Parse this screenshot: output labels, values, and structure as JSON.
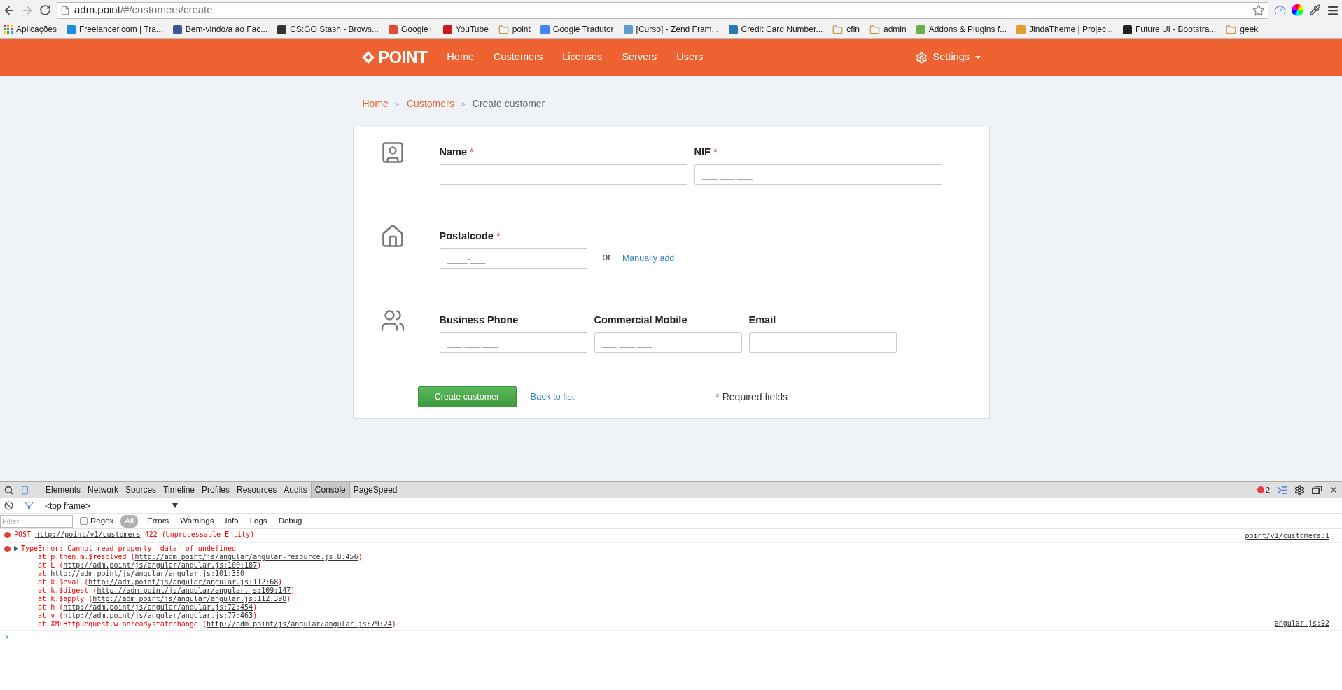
{
  "browser": {
    "url_host": "adm.point",
    "url_path": "/#/customers/create",
    "bookmarks": [
      {
        "kind": "apps",
        "label": "Aplicações"
      },
      {
        "kind": "site",
        "label": "Freelancer.com | Tra...",
        "color": "#1d8fd8"
      },
      {
        "kind": "site",
        "label": "Bem-vindo/a ao Fac...",
        "color": "#3b5998"
      },
      {
        "kind": "site",
        "label": "CS:GO Stash - Brows...",
        "color": "#333333"
      },
      {
        "kind": "site",
        "label": "Google+",
        "color": "#dd4b39"
      },
      {
        "kind": "site",
        "label": "YouTube",
        "color": "#cc181e"
      },
      {
        "kind": "folder",
        "label": "point"
      },
      {
        "kind": "site",
        "label": "Google Tradutor",
        "color": "#4285f4"
      },
      {
        "kind": "site",
        "label": "[Curso] - Zend Fram...",
        "color": "#5aa0c8"
      },
      {
        "kind": "site",
        "label": "Credit Card Number...",
        "color": "#2a7ab0"
      },
      {
        "kind": "folder",
        "label": "cfin"
      },
      {
        "kind": "folder",
        "label": "admin"
      },
      {
        "kind": "site",
        "label": "Addons & Plugins f...",
        "color": "#6ab04c"
      },
      {
        "kind": "site",
        "label": "JindaTheme | Projec...",
        "color": "#e0a030"
      },
      {
        "kind": "site",
        "label": "Future UI - Bootstra...",
        "color": "#222222"
      },
      {
        "kind": "folder",
        "label": "geek"
      }
    ]
  },
  "navbar": {
    "brand": "POINT",
    "items": [
      "Home",
      "Customers",
      "Licenses",
      "Servers",
      "Users"
    ],
    "settings": "Settings"
  },
  "breadcrumb": [
    {
      "kind": "link",
      "label": "Home"
    },
    {
      "kind": "separator",
      "label": "»"
    },
    {
      "kind": "link",
      "label": "Customers"
    },
    {
      "kind": "separator",
      "label": "»"
    },
    {
      "kind": "current",
      "label": "Create customer"
    }
  ],
  "form": {
    "sections": [
      {
        "kind": "identity",
        "fields": [
          {
            "label": "Name",
            "required": true
          },
          {
            "label": "NIF",
            "required": true,
            "placeholder": "___ ___ ___"
          }
        ]
      },
      {
        "kind": "address",
        "fields": [
          {
            "label": "Postalcode",
            "required": true,
            "placeholder": "____-___"
          }
        ],
        "or_text": "or",
        "link": "Manually add"
      },
      {
        "kind": "contacts",
        "fields": [
          {
            "label": "Business Phone",
            "required": false,
            "placeholder": "___ ___ ___"
          },
          {
            "label": "Commercial Mobile",
            "required": false,
            "placeholder": "___ ___ ___"
          },
          {
            "label": "Email",
            "required": false
          }
        ]
      }
    ],
    "submit": "Create customer",
    "back_link": "Back to list",
    "required_mark": "*",
    "required_note": "Required fields"
  },
  "devtools": {
    "tabs": [
      {
        "label": "Elements",
        "selected": false
      },
      {
        "label": "Network",
        "selected": false
      },
      {
        "label": "Sources",
        "selected": false
      },
      {
        "label": "Timeline",
        "selected": false
      },
      {
        "label": "Profiles",
        "selected": false
      },
      {
        "label": "Resources",
        "selected": false
      },
      {
        "label": "Audits",
        "selected": false
      },
      {
        "label": "Console",
        "selected": true
      },
      {
        "label": "PageSpeed",
        "selected": false
      }
    ],
    "error_count": "2",
    "frame": "<top frame>",
    "filter_placeholder": "Filter",
    "regex": {
      "label": "Regex",
      "checked": false
    },
    "levels": [
      {
        "label": "All",
        "selected": true
      },
      {
        "label": "Errors",
        "selected": false
      },
      {
        "label": "Warnings",
        "selected": false
      },
      {
        "label": "Info",
        "selected": false
      },
      {
        "label": "Logs",
        "selected": false
      },
      {
        "label": "Debug",
        "selected": false
      }
    ],
    "messages": [
      {
        "expandable": false,
        "source": "point/v1/customers:1",
        "lines": [
          {
            "before": "POST ",
            "link": "http://point/v1/customers",
            "after": " 422 (Unprocessable Entity)"
          }
        ]
      },
      {
        "expandable": true,
        "source": "angular.js:92",
        "lines": [
          {
            "before": "TypeError: Cannot read property 'data' of undefined"
          },
          {
            "before": "    at p.then.m.$resolved (",
            "link": "http://adm.point/js/angular/angular-resource.js:8:456",
            "after": ")"
          },
          {
            "before": "    at L (",
            "link": "http://adm.point/js/angular/angular.js:100:187",
            "after": ")"
          },
          {
            "before": "    at ",
            "link": "http://adm.point/js/angular/angular.js:101:350"
          },
          {
            "before": "    at k.$eval (",
            "link": "http://adm.point/js/angular/angular.js:112:68",
            "after": ")"
          },
          {
            "before": "    at k.$digest (",
            "link": "http://adm.point/js/angular/angular.js:109:147",
            "after": ")"
          },
          {
            "before": "    at k.$apply (",
            "link": "http://adm.point/js/angular/angular.js:112:398",
            "after": ")"
          },
          {
            "before": "    at h (",
            "link": "http://adm.point/js/angular/angular.js:72:454",
            "after": ")"
          },
          {
            "before": "    at v (",
            "link": "http://adm.point/js/angular/angular.js:77:463",
            "after": ")"
          },
          {
            "before": "    at XMLHttpRequest.w.onreadystatechange (",
            "link": "http://adm.point/js/angular/angular.js:79:24",
            "after": ")"
          }
        ]
      }
    ],
    "prompt": "›"
  }
}
